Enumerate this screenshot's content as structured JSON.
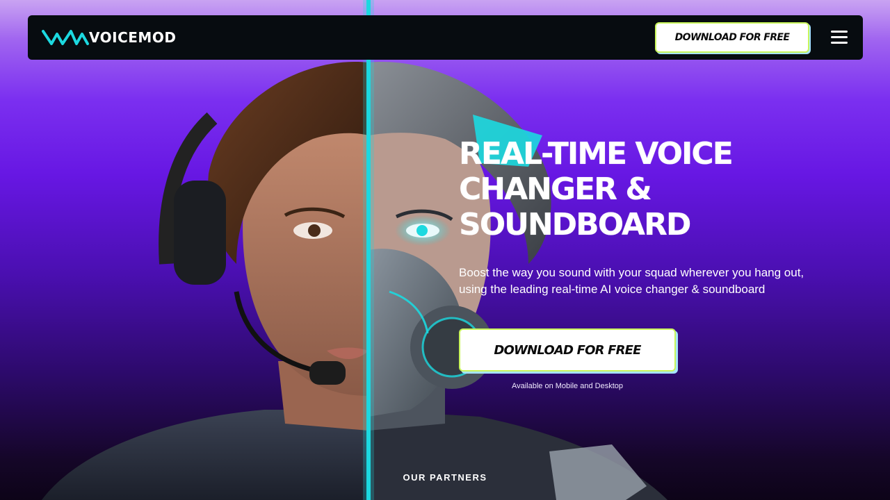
{
  "brand": {
    "name": "VOICEMOD",
    "logo_icon": "voicemod-wave-logo",
    "accent": "#1cd9e0"
  },
  "navbar": {
    "download_label": "DOWNLOAD FOR FREE",
    "menu_icon": "hamburger-menu-icon"
  },
  "hero": {
    "headline_lines": [
      "REAL-TIME VOICE",
      "CHANGER &",
      "SOUNDBOARD"
    ],
    "subtitle_line1": "Boost the way you sound with your squad wherever you hang out,",
    "subtitle_line2": "using the leading real-time AI voice changer & soundboard",
    "cta_label": "DOWNLOAD FOR FREE",
    "cta_note": "Available on Mobile and Desktop"
  },
  "partners": {
    "title": "OUR PARTNERS"
  },
  "colors": {
    "background_top": "#c9a3f2",
    "background_mid": "#6717e3",
    "background_bottom": "#0d0418",
    "navbar_bg": "#070c10",
    "button_bg": "#ffffff",
    "button_outline": "#c8f55a",
    "divider_glow": "#1cd9e0"
  }
}
